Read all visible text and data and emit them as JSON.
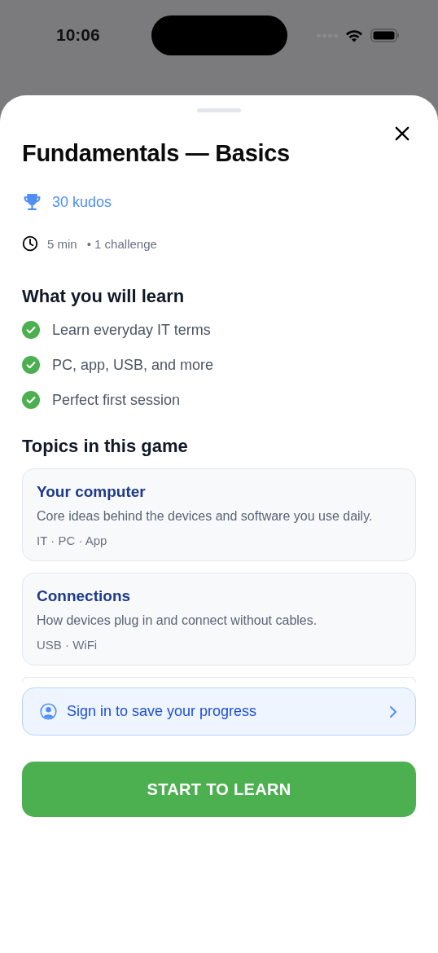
{
  "status_bar": {
    "time": "10:06"
  },
  "sheet": {
    "title": "Fundamentals — Basics",
    "reward": "30 kudos",
    "duration": "5 min",
    "challenges": "• 1 challenge"
  },
  "learn": {
    "heading": "What you will learn",
    "items": [
      {
        "text": "Learn everyday IT terms",
        "checked": true
      },
      {
        "text": "PC, app, USB, and more",
        "checked": true
      },
      {
        "text": "Perfect first session",
        "checked": true
      }
    ]
  },
  "topics": {
    "heading": "Topics in this game",
    "items": [
      {
        "title": "Your computer",
        "description": "Core ideas behind the devices and software you use daily.",
        "tags": "IT · PC · App"
      },
      {
        "title": "Connections",
        "description": "How devices plug in and connect without cables.",
        "tags": "USB · WiFi"
      }
    ]
  },
  "sign_in": {
    "label": "Sign in to save your progress"
  },
  "primary_button": {
    "label": "START TO LEARN"
  }
}
